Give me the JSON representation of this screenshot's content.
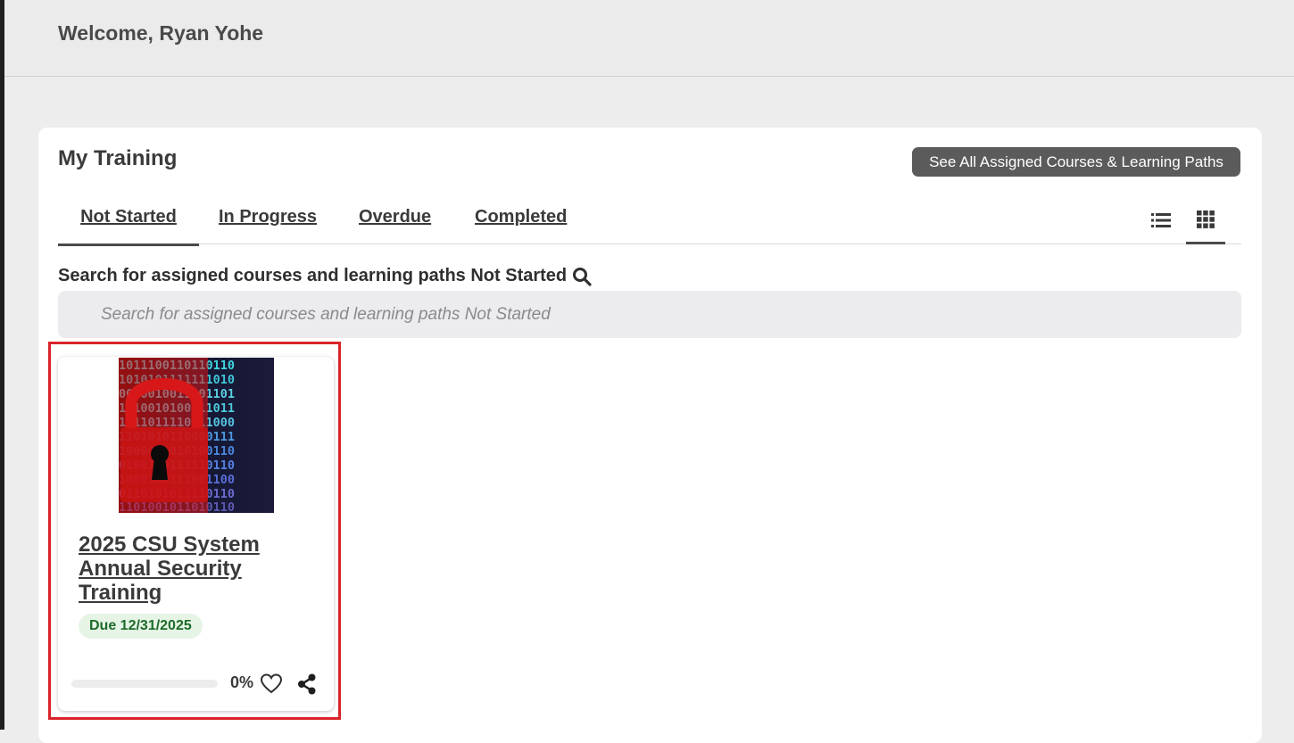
{
  "header": {
    "welcome_text": "Welcome, Ryan Yohe"
  },
  "training": {
    "title": "My Training",
    "see_all_label": "See All Assigned Courses & Learning Paths",
    "tabs": [
      {
        "label": "Not Started",
        "active": true
      },
      {
        "label": "In Progress",
        "active": false
      },
      {
        "label": "Overdue",
        "active": false
      },
      {
        "label": "Completed",
        "active": false
      }
    ],
    "views": [
      {
        "icon": "list-view-icon",
        "active": false
      },
      {
        "icon": "grid-view-icon",
        "active": true
      }
    ],
    "search": {
      "label": "Search for assigned courses and learning paths Not Started",
      "placeholder": "Search for assigned courses and learning paths Not Started"
    },
    "courses": [
      {
        "title": "2025 CSU System Annual Security Training",
        "due": "Due 12/31/2025",
        "progress": 0,
        "progress_text": "0%",
        "thumbnail_icon": "padlock-binary-icon"
      }
    ]
  },
  "colors": {
    "page_bg": "#ededee",
    "button_bg": "#5b5b5b",
    "highlight": "#d9242b",
    "due_badge_bg": "#e6f4e6",
    "due_badge_text": "#1e6b2a"
  }
}
